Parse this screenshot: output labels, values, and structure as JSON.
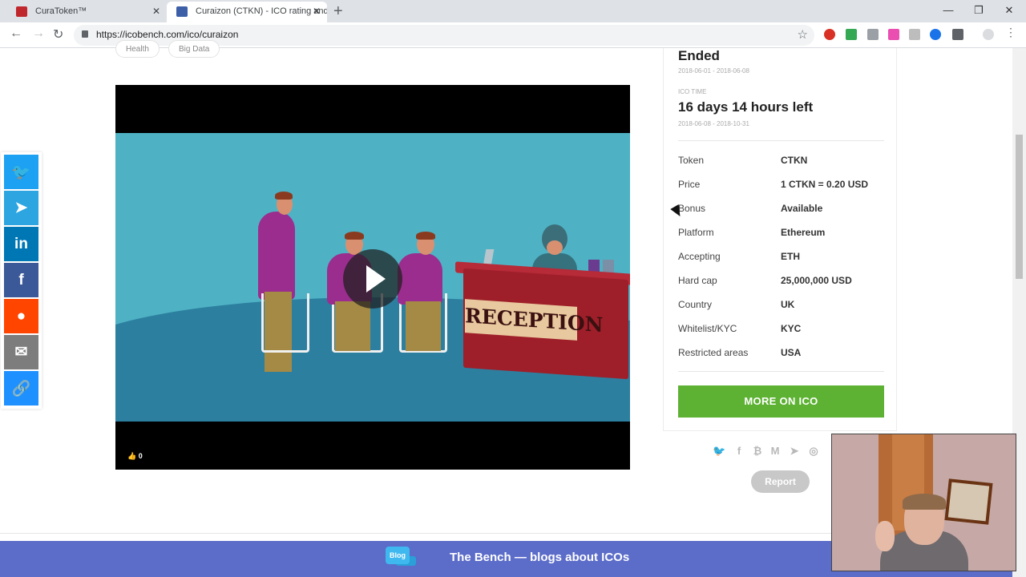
{
  "browser": {
    "tabs": [
      {
        "title": "CuraToken™",
        "favicon_color": "#c0272d"
      },
      {
        "title": "Curaizon (CTKN) - ICO rating and",
        "favicon_color": "#3c5fa8"
      }
    ],
    "url": "https://icobench.com/ico/curaizon",
    "new_tab_label": "+",
    "close_label": "✕",
    "window_controls": {
      "minimize": "—",
      "restore": "❐",
      "close": "✕"
    },
    "nav": {
      "back": "←",
      "forward": "→",
      "reload": "↻"
    },
    "bookmark_icon": "☆"
  },
  "tags": [
    "Health",
    "Big Data"
  ],
  "video": {
    "sign_text": "RECEPTION",
    "likes": "0",
    "like_icon": "👍"
  },
  "share_rail": [
    {
      "name": "twitter",
      "glyph": "🐦",
      "color": "#1da1f2"
    },
    {
      "name": "telegram",
      "glyph": "➤",
      "color": "#2ca5e0"
    },
    {
      "name": "linkedin",
      "glyph": "in",
      "color": "#0077b5"
    },
    {
      "name": "facebook",
      "glyph": "f",
      "color": "#3b5998"
    },
    {
      "name": "reddit",
      "glyph": "●",
      "color": "#ff4500"
    },
    {
      "name": "email",
      "glyph": "✉",
      "color": "#7d7d7d"
    },
    {
      "name": "copy-link",
      "glyph": "🔗",
      "color": "#1e90ff"
    }
  ],
  "ico_card": {
    "status_label": "Ended",
    "presale_dates": "2018-06-01 - 2018-06-08",
    "ico_time_label": "ICO TIME",
    "time_left": "16 days 14 hours left",
    "ico_dates": "2018-06-08 - 2018-10-31",
    "rows": [
      {
        "label": "Token",
        "value": "CTKN"
      },
      {
        "label": "Price",
        "value": "1 CTKN = 0.20 USD"
      },
      {
        "label": "Bonus",
        "value": "Available"
      },
      {
        "label": "Platform",
        "value": "Ethereum"
      },
      {
        "label": "Accepting",
        "value": "ETH"
      },
      {
        "label": "Hard cap",
        "value": "25,000,000 USD"
      },
      {
        "label": "Country",
        "value": "UK"
      },
      {
        "label": "Whitelist/KYC",
        "value": "KYC"
      },
      {
        "label": "Restricted areas",
        "value": "USA"
      }
    ],
    "cta_label": "MORE ON ICO",
    "cta_color": "#5db233"
  },
  "project_links": [
    "🐦",
    "f",
    "₿",
    "M",
    "➤",
    "◎"
  ],
  "report_label": "Report",
  "banner": {
    "badge": "Blog",
    "text": "The Bench — blogs about ICOs",
    "color": "#5b6cc9"
  }
}
